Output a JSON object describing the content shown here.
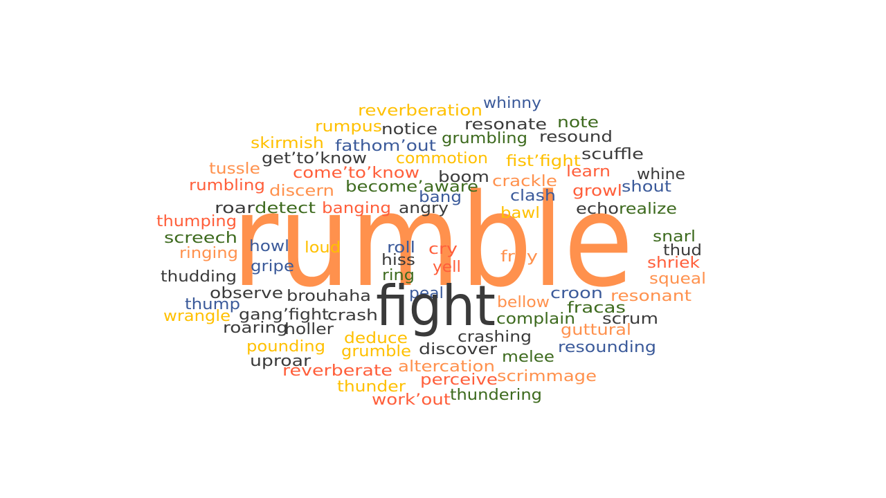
{
  "palette": {
    "yellow": "#ffc000",
    "dark": "#3a3a3a",
    "blue": "#3b5a9a",
    "green": "#3d6a1e",
    "red": "#ff5e3a",
    "orange": "#ff914d"
  },
  "main_word": {
    "text": "rumble",
    "color": "orange"
  },
  "secondary_word": {
    "text": "fight",
    "color": "dark"
  },
  "words": [
    {
      "text": "reverberation",
      "color": "yellow"
    },
    {
      "text": "whinny",
      "color": "blue"
    },
    {
      "text": "rumpus",
      "color": "yellow"
    },
    {
      "text": "notice",
      "color": "dark"
    },
    {
      "text": "resonate",
      "color": "dark"
    },
    {
      "text": "note",
      "color": "green"
    },
    {
      "text": "resound",
      "color": "dark"
    },
    {
      "text": "skirmish",
      "color": "yellow"
    },
    {
      "text": "fathom’out",
      "color": "blue"
    },
    {
      "text": "grumbling",
      "color": "green"
    },
    {
      "text": "scuffle",
      "color": "dark"
    },
    {
      "text": "get’to’know",
      "color": "dark"
    },
    {
      "text": "commotion",
      "color": "yellow"
    },
    {
      "text": "fist’fight",
      "color": "yellow"
    },
    {
      "text": "tussle",
      "color": "orange"
    },
    {
      "text": "come’to’know",
      "color": "red"
    },
    {
      "text": "boom",
      "color": "dark"
    },
    {
      "text": "learn",
      "color": "red"
    },
    {
      "text": "whine",
      "color": "dark"
    },
    {
      "text": "rumbling",
      "color": "red"
    },
    {
      "text": "discern",
      "color": "orange"
    },
    {
      "text": "become’aware",
      "color": "green"
    },
    {
      "text": "crackle",
      "color": "orange"
    },
    {
      "text": "growl",
      "color": "red"
    },
    {
      "text": "shout",
      "color": "blue"
    },
    {
      "text": "bang",
      "color": "blue"
    },
    {
      "text": "clash",
      "color": "blue"
    },
    {
      "text": "roar",
      "color": "dark"
    },
    {
      "text": "detect",
      "color": "green"
    },
    {
      "text": "banging",
      "color": "red"
    },
    {
      "text": "angry",
      "color": "dark"
    },
    {
      "text": "bawl",
      "color": "yellow"
    },
    {
      "text": "echo",
      "color": "dark"
    },
    {
      "text": "realize",
      "color": "green"
    },
    {
      "text": "thumping",
      "color": "red"
    },
    {
      "text": "screech",
      "color": "green"
    },
    {
      "text": "howl",
      "color": "blue"
    },
    {
      "text": "loud",
      "color": "yellow"
    },
    {
      "text": "roll",
      "color": "blue"
    },
    {
      "text": "cry",
      "color": "red"
    },
    {
      "text": "fray",
      "color": "orange"
    },
    {
      "text": "snarl",
      "color": "green"
    },
    {
      "text": "thud",
      "color": "dark"
    },
    {
      "text": "ringing",
      "color": "orange"
    },
    {
      "text": "gripe",
      "color": "blue"
    },
    {
      "text": "hiss",
      "color": "dark"
    },
    {
      "text": "yell",
      "color": "red"
    },
    {
      "text": "shriek",
      "color": "red"
    },
    {
      "text": "thudding",
      "color": "dark"
    },
    {
      "text": "ring",
      "color": "green"
    },
    {
      "text": "squeal",
      "color": "orange"
    },
    {
      "text": "observe",
      "color": "dark"
    },
    {
      "text": "brouhaha",
      "color": "dark"
    },
    {
      "text": "peal",
      "color": "blue"
    },
    {
      "text": "croon",
      "color": "blue"
    },
    {
      "text": "resonant",
      "color": "orange"
    },
    {
      "text": "thump",
      "color": "blue"
    },
    {
      "text": "bellow",
      "color": "orange"
    },
    {
      "text": "fracas",
      "color": "green"
    },
    {
      "text": "wrangle",
      "color": "yellow"
    },
    {
      "text": "gang’fight",
      "color": "dark"
    },
    {
      "text": "crash",
      "color": "dark"
    },
    {
      "text": "complain",
      "color": "green"
    },
    {
      "text": "scrum",
      "color": "dark"
    },
    {
      "text": "roaring",
      "color": "dark"
    },
    {
      "text": "holler",
      "color": "dark"
    },
    {
      "text": "guttural",
      "color": "orange"
    },
    {
      "text": "deduce",
      "color": "yellow"
    },
    {
      "text": "crashing",
      "color": "dark"
    },
    {
      "text": "pounding",
      "color": "yellow"
    },
    {
      "text": "grumble",
      "color": "yellow"
    },
    {
      "text": "discover",
      "color": "dark"
    },
    {
      "text": "resounding",
      "color": "blue"
    },
    {
      "text": "melee",
      "color": "green"
    },
    {
      "text": "uproar",
      "color": "dark"
    },
    {
      "text": "altercation",
      "color": "orange"
    },
    {
      "text": "reverberate",
      "color": "red"
    },
    {
      "text": "perceive",
      "color": "red"
    },
    {
      "text": "scrimmage",
      "color": "orange"
    },
    {
      "text": "thunder",
      "color": "yellow"
    },
    {
      "text": "thundering",
      "color": "green"
    },
    {
      "text": "work’out",
      "color": "red"
    }
  ]
}
